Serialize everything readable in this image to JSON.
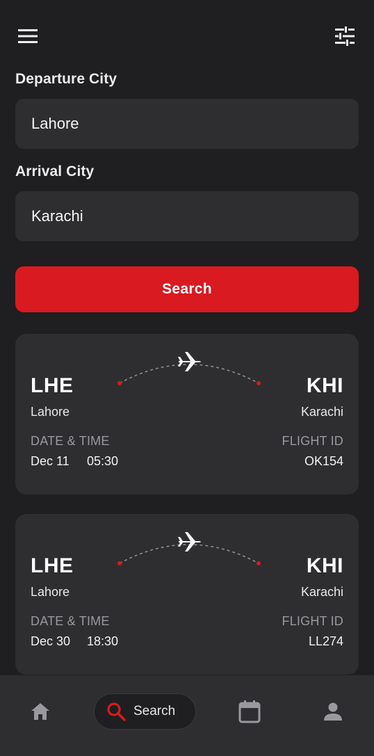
{
  "header": {
    "menu_icon": "hamburger-menu-icon",
    "filter_icon": "sliders-filter-icon"
  },
  "form": {
    "departure_label": "Departure City",
    "departure_value": "Lahore",
    "arrival_label": "Arrival City",
    "arrival_value": "Karachi",
    "search_button": "Search"
  },
  "flights": [
    {
      "from_code": "LHE",
      "from_city": "Lahore",
      "to_code": "KHI",
      "to_city": "Karachi",
      "datetime_label": "DATE & TIME",
      "date": "Dec 11",
      "time": "05:30",
      "flight_id_label": "FLIGHT ID",
      "flight_id": "OK154"
    },
    {
      "from_code": "LHE",
      "from_city": "Lahore",
      "to_code": "KHI",
      "to_city": "Karachi",
      "datetime_label": "DATE & TIME",
      "date": "Dec 30",
      "time": "18:30",
      "flight_id_label": "FLIGHT ID",
      "flight_id": "LL274"
    }
  ],
  "bottom_nav": {
    "home_icon": "home-icon",
    "search_label": "Search",
    "search_icon": "search-icon",
    "calendar_icon": "calendar-icon",
    "profile_icon": "person-icon"
  },
  "colors": {
    "background": "#1f1f21",
    "surface": "#2e2e31",
    "accent": "#d91a20",
    "muted_text": "#9a9a9e"
  }
}
